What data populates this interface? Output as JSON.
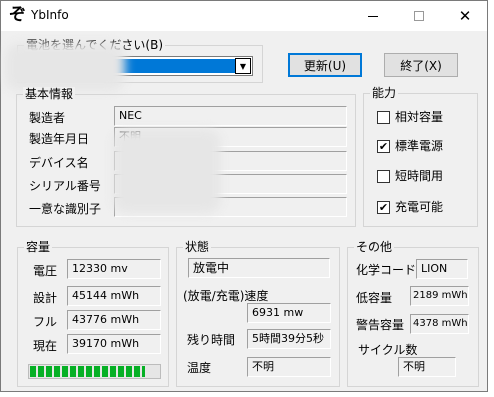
{
  "window": {
    "title": "YbInfo",
    "app_icon_glyph": "ぞ",
    "minimize_icon": "minimize-icon",
    "maximize_icon": "maximize-icon",
    "close_glyph": "✕"
  },
  "battery_select": {
    "label": "電池を選んでください(B)",
    "selected_value": ""
  },
  "buttons": {
    "update": "更新(U)",
    "exit": "終了(X)"
  },
  "basic_info": {
    "title": "基本情報",
    "rows": [
      {
        "label": "製造者",
        "value": "NEC"
      },
      {
        "label": "製造年月日",
        "value": "不明"
      },
      {
        "label": "デバイス名",
        "value": ""
      },
      {
        "label": "シリアル番号",
        "value": ""
      },
      {
        "label": "一意な識別子",
        "value": ""
      }
    ]
  },
  "capability": {
    "title": "能力",
    "items": [
      {
        "label": "相対容量",
        "checked": false
      },
      {
        "label": "標準電源",
        "checked": true
      },
      {
        "label": "短時間用",
        "checked": false
      },
      {
        "label": "充電可能",
        "checked": true
      }
    ],
    "check_glyph": "✔"
  },
  "capacity": {
    "title": "容量",
    "rows": [
      {
        "label": "電圧",
        "value": "12330 mv"
      },
      {
        "label": "設計",
        "value": "45144 mWh"
      },
      {
        "label": "フル",
        "value": "43776 mWh"
      },
      {
        "label": "現在",
        "value": "39170 mWh"
      }
    ],
    "charge_fraction": 0.89,
    "bar_color": "#06b025"
  },
  "status": {
    "title": "状態",
    "state_value": "放電中",
    "rate_label": "(放電/充電)速度",
    "rate_value": "6931 mw",
    "remaining_label": "残り時間",
    "remaining_value": "5時間39分5秒",
    "temperature_label": "温度",
    "temperature_value": "不明"
  },
  "other": {
    "title": "その他",
    "chemistry_label": "化学コード",
    "chemistry_value": "LION",
    "low_capacity_label": "低容量",
    "low_capacity_value": "2189 mWh",
    "warning_capacity_label": "警告容量",
    "warning_capacity_value": "4378 mWh",
    "cycle_label": "サイクル数",
    "cycle_value": "不明"
  },
  "colors": {
    "accent": "#0078d7",
    "window_bg": "#f0f0f0"
  }
}
